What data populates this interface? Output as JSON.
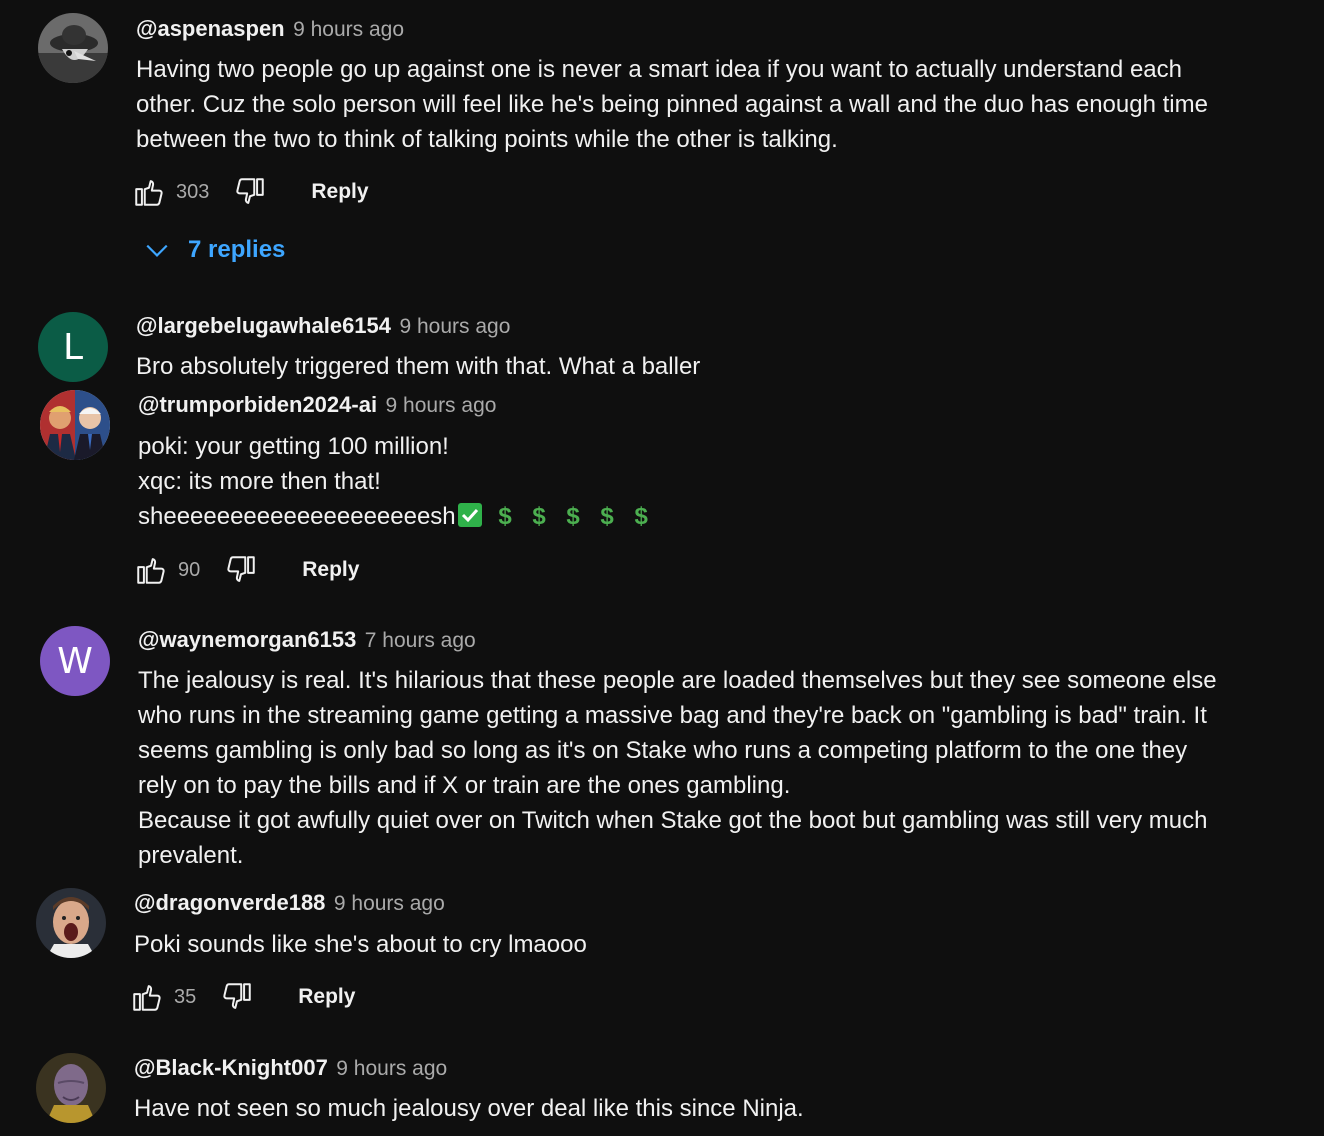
{
  "comments": [
    {
      "author": "@aspenaspen",
      "time": "9 hours ago",
      "avatar": {
        "kind": "photo",
        "icon": "masked-figure-avatar"
      },
      "lines": [
        "Having two people go up against one is never a smart idea if you want to actually understand each",
        "other. Cuz the solo person will feel like he's being pinned against a wall and the duo has enough time",
        "between the two to think of talking points while the other is talking."
      ],
      "likes": "303",
      "reply_label": "Reply",
      "replies_label": "7 replies"
    },
    {
      "author": "@largebelugawhale6154",
      "time": "9 hours ago",
      "avatar": {
        "kind": "letter",
        "letter": "L",
        "color": "#0b5c46"
      },
      "lines": [
        "Bro absolutely triggered them with that. What a baller"
      ]
    },
    {
      "author": "@trumporbiden2024-ai",
      "time": "9 hours ago",
      "avatar": {
        "kind": "photo",
        "icon": "two-politicians-avatar"
      },
      "lines": [
        "poki: your getting 100 million!",
        "xqc: its more then that!",
        "sheeeeeeeeeeeeeeeeeeeesh"
      ],
      "emoji_suffix": [
        "check-mark-emoji",
        "$",
        "$",
        "$",
        "$",
        "$"
      ],
      "likes": "90",
      "reply_label": "Reply"
    },
    {
      "author": "@waynemorgan6153",
      "time": "7 hours ago",
      "avatar": {
        "kind": "letter",
        "letter": "W",
        "color": "#7e57c2"
      },
      "lines": [
        "The jealousy is real. It's hilarious that these people are loaded themselves but they see someone else",
        "who runs in the streaming game getting a massive bag and they're back on \"gambling is bad\" train. It",
        "seems gambling is only bad so long as it's on Stake who runs a competing platform to the one they",
        "rely on to pay the bills and if X or train are the ones gambling.",
        "Because it got awfully quiet over on Twitch when Stake got the boot but gambling was still very much",
        "prevalent."
      ]
    },
    {
      "author": "@dragonverde188",
      "time": "9 hours ago",
      "avatar": {
        "kind": "photo",
        "icon": "shouting-man-avatar"
      },
      "lines": [
        "Poki sounds like she's about to cry lmaooo"
      ],
      "likes": "35",
      "reply_label": "Reply"
    },
    {
      "author": "@Black-Knight007",
      "time": "9 hours ago",
      "avatar": {
        "kind": "photo",
        "icon": "thanos-avatar"
      },
      "lines": [
        "Have not seen so much jealousy over deal like this since Ninja."
      ]
    }
  ],
  "colors": {
    "background": "#0f0f0f",
    "text": "#f1f1f1",
    "secondary_text": "#aaaaaa",
    "link_blue": "#3ea6ff",
    "money_green": "#4caf50"
  }
}
